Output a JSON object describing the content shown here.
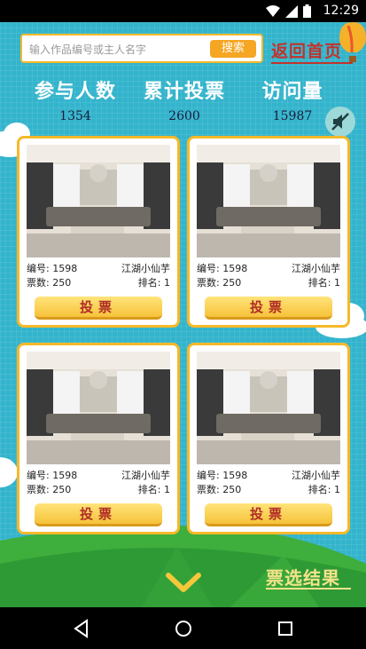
{
  "status_bar": {
    "time": "12:29"
  },
  "search": {
    "placeholder": "输入作品编号或主人名字",
    "button_label": "搜索"
  },
  "header": {
    "back_home_label": "返回首页"
  },
  "stats": [
    {
      "label": "参与人数",
      "value": "1354"
    },
    {
      "label": "累计投票",
      "value": "2600"
    },
    {
      "label": "访问量",
      "value": "15987"
    }
  ],
  "entries": [
    {
      "id_label": "编号: 1598",
      "name": "江湖小仙芋",
      "votes_label": "票数: 250",
      "rank_label": "排名: 1",
      "vote_button": "投票"
    },
    {
      "id_label": "编号: 1598",
      "name": "江湖小仙芋",
      "votes_label": "票数: 250",
      "rank_label": "排名: 1",
      "vote_button": "投票"
    },
    {
      "id_label": "编号: 1598",
      "name": "江湖小仙芋",
      "votes_label": "票数: 250",
      "rank_label": "排名: 1",
      "vote_button": "投票"
    },
    {
      "id_label": "编号: 1598",
      "name": "江湖小仙芋",
      "votes_label": "票数: 250",
      "rank_label": "排名: 1",
      "vote_button": "投票"
    }
  ],
  "footer": {
    "results_label": "票选结果"
  },
  "icons": {
    "status": [
      "wifi-icon",
      "signal-icon",
      "battery-icon"
    ],
    "mute": "mute-icon",
    "scroll": "chevron-down-icon",
    "nav": [
      "back-icon",
      "home-icon",
      "recents-icon"
    ]
  },
  "colors": {
    "accent": "#f5b92a",
    "background": "#34b7cf",
    "title_red": "#c2332b",
    "grass": "#2e9a35"
  }
}
